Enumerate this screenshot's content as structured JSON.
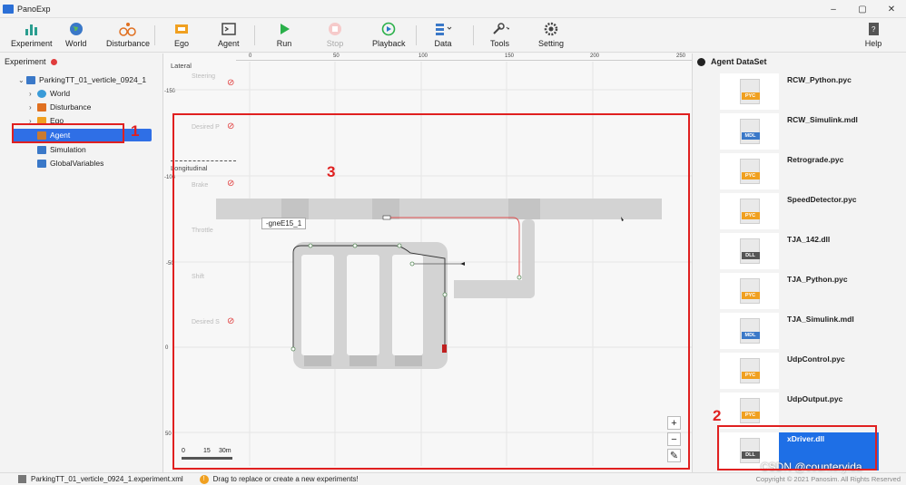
{
  "window": {
    "title": "PanoExp",
    "controls": [
      "–",
      "▢",
      "✕"
    ]
  },
  "toolbar": {
    "experiment": "Experiment",
    "world": "World",
    "disturbance": "Disturbance",
    "ego": "Ego",
    "agent": "Agent",
    "run": "Run",
    "stop": "Stop",
    "playback": "Playback",
    "data": "Data",
    "tools": "Tools",
    "setting": "Setting",
    "help": "Help"
  },
  "left_panel": {
    "header": "Experiment",
    "root": "ParkingTT_01_verticle_0924_1",
    "items": [
      "World",
      "Disturbance",
      "Ego",
      "Agent",
      "Simulation",
      "GlobalVariables"
    ]
  },
  "canvas": {
    "top_ticks": [
      "0",
      "50",
      "100",
      "150",
      "200",
      "250"
    ],
    "left_ticks": [
      "-150",
      "-100",
      "-50",
      "0",
      "50"
    ],
    "lateral_label": "Lateral",
    "longitudinal_label": "Longitudinal",
    "rows": [
      "Steering",
      "Desired P",
      "Brake",
      "Throttle",
      "Shift",
      "Desired S"
    ],
    "edge_label": "-gneE15_1",
    "scale": [
      "0",
      "15",
      "30m"
    ],
    "zoom_in": "+",
    "zoom_out": "−",
    "ruler": "✎"
  },
  "right_panel": {
    "header": "Agent DataSet",
    "files": [
      {
        "name": "RCW_Python.pyc",
        "tag": "PYC"
      },
      {
        "name": "RCW_Simulink.mdl",
        "tag": "MDL"
      },
      {
        "name": "Retrograde.pyc",
        "tag": "PYC"
      },
      {
        "name": "SpeedDetector.pyc",
        "tag": "PYC"
      },
      {
        "name": "TJA_142.dll",
        "tag": "DLL"
      },
      {
        "name": "TJA_Python.pyc",
        "tag": "PYC"
      },
      {
        "name": "TJA_Simulink.mdl",
        "tag": "MDL"
      },
      {
        "name": "UdpControl.pyc",
        "tag": "PYC"
      },
      {
        "name": "UdpOutput.pyc",
        "tag": "PYC"
      },
      {
        "name": "xDriver.dll",
        "tag": "DLL"
      }
    ]
  },
  "statusbar": {
    "file": "ParkingTT_01_verticle_0924_1.experiment.xml",
    "hint": "Drag to replace or create a new experiments!",
    "copyright": "Copyright © 2021 Panosim. All Rights Reserved"
  },
  "annotations": {
    "a1": "1",
    "a2": "2",
    "a3": "3"
  },
  "watermark": "CSDN @counteryida",
  "colors": {
    "accent": "#2f6fe6",
    "annotation": "#e02020",
    "pyc": "#f0a020",
    "mdl": "#3a78c8",
    "dll": "#555555"
  }
}
